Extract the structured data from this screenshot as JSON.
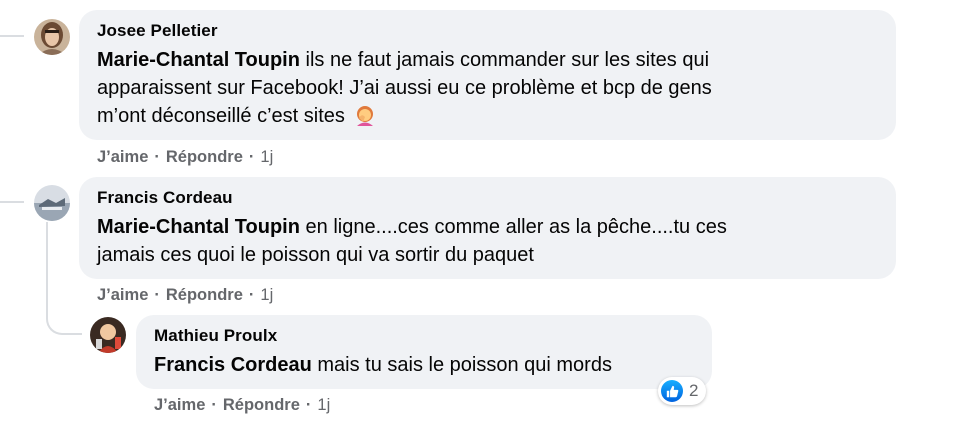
{
  "comments": [
    {
      "author": "Josee Pelletier",
      "mention": "Marie-Chantal Toupin",
      "line1": " ils ne faut jamais commander sur les sites qui",
      "line2": "apparaissent sur Facebook! J’ai aussi eu ce problème et bcp de gens",
      "line3": "m’ont déconseillé c’est sites",
      "emoji": "woman-facepalming-emoji",
      "like": "J’aime",
      "reply": "Répondre",
      "time": "1j"
    },
    {
      "author": "Francis Cordeau",
      "mention": "Marie-Chantal Toupin",
      "line1": " en ligne....ces comme aller as la pêche....tu ces",
      "line2": "jamais ces quoi le poisson qui va sortir du paquet",
      "like": "J’aime",
      "reply": "Répondre",
      "time": "1j"
    },
    {
      "author": "Mathieu Proulx",
      "mention": "Francis Cordeau",
      "line1": " mais tu sais le poisson qui mords",
      "like": "J’aime",
      "reply": "Répondre",
      "time": "1j",
      "reaction_icon": "like-icon",
      "reaction_count": "2"
    }
  ],
  "colors": {
    "bubble": "#f0f2f5",
    "meta": "#65676b",
    "like_blue": "#1877f2"
  }
}
